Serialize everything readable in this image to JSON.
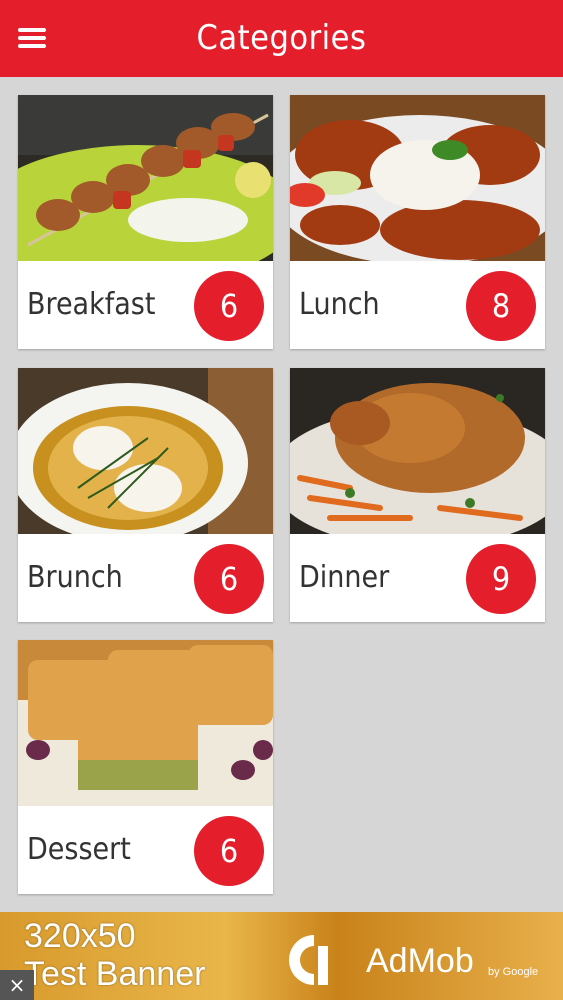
{
  "header": {
    "title": "Categories",
    "menu_icon": "hamburger-icon"
  },
  "categories": [
    {
      "name": "Breakfast",
      "count": "6"
    },
    {
      "name": "Lunch",
      "count": "8"
    },
    {
      "name": "Brunch",
      "count": "6"
    },
    {
      "name": "Dinner",
      "count": "9"
    },
    {
      "name": "Dessert",
      "count": "6"
    }
  ],
  "ad": {
    "size_text": "320x50",
    "test_text": "Test Banner",
    "brand": "AdMob",
    "by": "by Google",
    "close": "×"
  },
  "colors": {
    "accent": "#e41e2b",
    "background": "#d6d6d6"
  }
}
